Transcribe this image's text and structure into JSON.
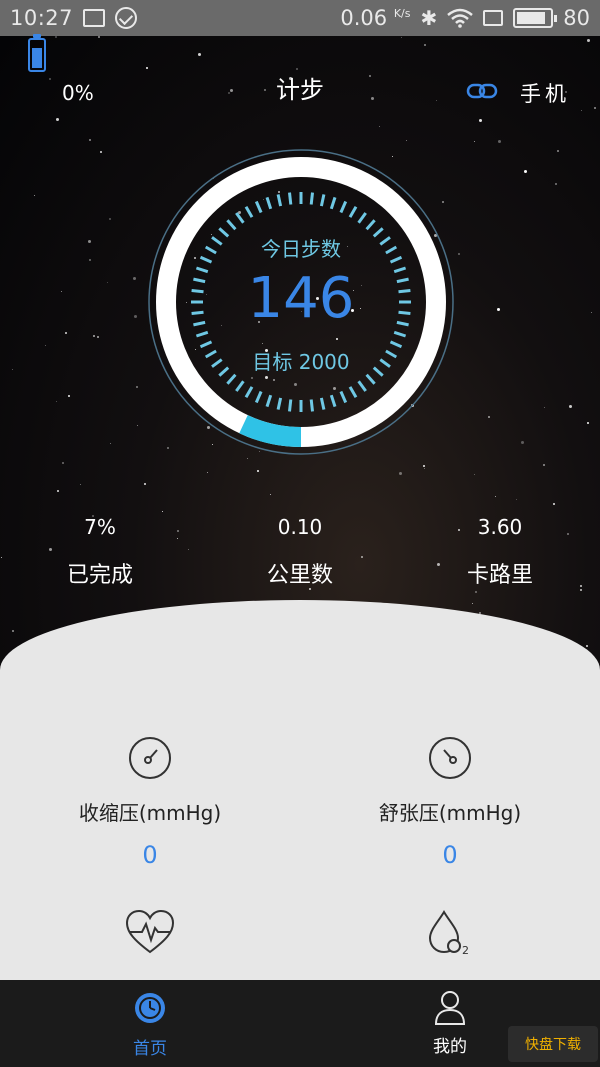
{
  "status_bar": {
    "time": "10:27",
    "speed": "0.06",
    "speed_unit": "K/s",
    "battery": "80"
  },
  "header": {
    "battery_text": "0%",
    "title": "计步",
    "device_text": "手机",
    "accent_color": "#3a86e6"
  },
  "ring": {
    "title": "今日步数",
    "steps": "146",
    "goal": "目标 2000",
    "progress_fraction": 0.07
  },
  "stats": [
    {
      "value": "7%",
      "label": "已完成"
    },
    {
      "value": "0.10",
      "label": "公里数"
    },
    {
      "value": "3.60",
      "label": "卡路里"
    }
  ],
  "cards": [
    {
      "icon": "gauge-icon",
      "label": "收缩压(mmHg)",
      "value": "0"
    },
    {
      "icon": "gauge-icon",
      "label": "舒张压(mmHg)",
      "value": "0"
    },
    {
      "icon": "heart-rate-icon",
      "label": "",
      "value": ""
    },
    {
      "icon": "oxygen-drop-icon",
      "label": "",
      "value": ""
    }
  ],
  "bottom_nav": {
    "items": [
      {
        "label": "首页",
        "icon": "clock-icon",
        "active": true
      },
      {
        "label": "我的",
        "icon": "person-icon",
        "active": false
      }
    ]
  }
}
